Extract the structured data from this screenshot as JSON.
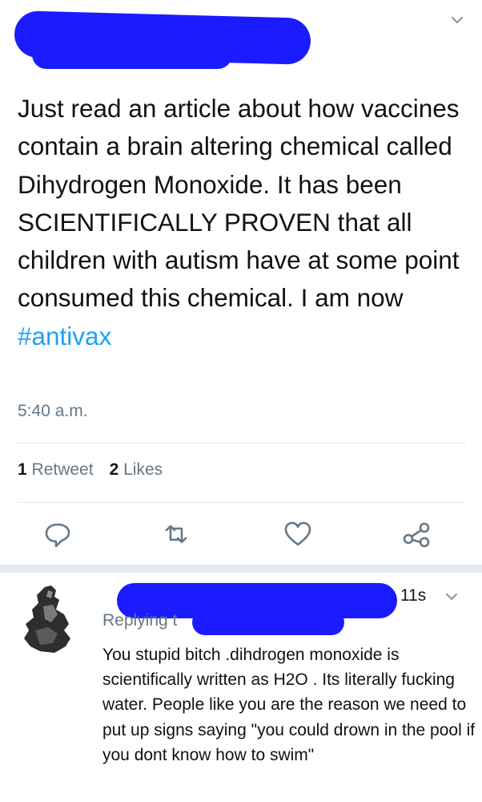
{
  "tweet": {
    "text_parts": [
      "Just read an article about how vaccines contain a brain altering chemical called Dihydrogen Monoxide. It has been SCIENTIFICALLY PROVEN that all children with autism have at some point consumed this chemical. I am now ",
      "#antivax"
    ],
    "time": "5:40 a.m.",
    "retweet_count": "1",
    "retweet_label": "Retweet",
    "like_count": "2",
    "like_label": "Likes",
    "actions": [
      "reply-icon",
      "retweet-icon",
      "like-icon",
      "share-icon"
    ]
  },
  "reply": {
    "time": "11s",
    "replying_prefix": "Replying t",
    "text": "You stupid bitch .dihdrogen monoxide is scientifically written as H2O . Its literally fucking water. People like you are the reason we need to put up signs saying \"you could drown in the pool if you dont know how to swim\""
  },
  "colors": {
    "link": "#1da1f2",
    "secondary_text": "#657786",
    "icon": "#657786",
    "redaction": "#1b1bff",
    "divider": "#e1e8ed"
  }
}
